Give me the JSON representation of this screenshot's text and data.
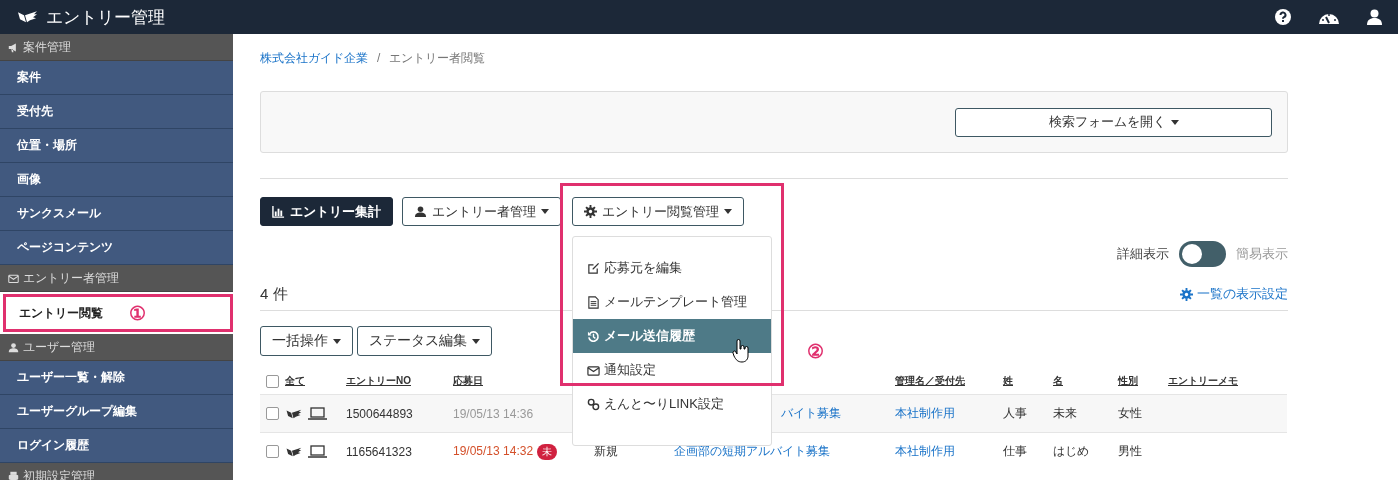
{
  "header": {
    "title": "エントリー管理"
  },
  "sidebar": {
    "sections": [
      {
        "title": "案件管理",
        "items": [
          {
            "label": "案件",
            "selected": false
          },
          {
            "label": "受付先",
            "selected": false
          },
          {
            "label": "位置・場所",
            "selected": false
          },
          {
            "label": "画像",
            "selected": false
          },
          {
            "label": "サンクスメール",
            "selected": false
          },
          {
            "label": "ページコンテンツ",
            "selected": false
          }
        ]
      },
      {
        "title": "エントリー者管理",
        "items": [
          {
            "label": "エントリー閲覧",
            "selected": true,
            "annotation": "①"
          }
        ]
      },
      {
        "title": "ユーザー管理",
        "items": [
          {
            "label": "ユーザー一覧・解除",
            "selected": false
          },
          {
            "label": "ユーザーグループ編集",
            "selected": false
          },
          {
            "label": "ログイン履歴",
            "selected": false
          }
        ]
      },
      {
        "title": "初期設定管理"
      }
    ]
  },
  "breadcrumb": {
    "separator": "/",
    "items": [
      {
        "label": "株式会社ガイド企業",
        "kind": "link"
      },
      {
        "label": "エントリー者閲覧",
        "kind": "current"
      }
    ]
  },
  "search_panel": {
    "button": "検索フォームを開く"
  },
  "toolbar": [
    {
      "label": "エントリー集計",
      "kind": "primary",
      "open": false
    },
    {
      "label": "エントリー者管理",
      "kind": "dropdown",
      "open": false
    },
    {
      "label": "エントリー閲覧管理",
      "kind": "dropdown",
      "open": true,
      "annotation": "②",
      "menu": [
        {
          "label": "応募元を編集",
          "selected": false
        },
        {
          "label": "メールテンプレート管理",
          "selected": false
        },
        {
          "label": "メール送信履歴",
          "selected": true
        },
        {
          "label": "通知設定",
          "selected": false
        },
        {
          "label": "えんと〜りLINK設定",
          "selected": false
        }
      ]
    }
  ],
  "view_toggle": {
    "left_label": "詳細表示",
    "right_label": "簡易表示",
    "on": false
  },
  "count": "4 件",
  "display_settings_link": "一覧の表示設定",
  "bulk_buttons": [
    "一括操作",
    "ステータス編集"
  ],
  "table": {
    "select_all_checked": false,
    "columns": [
      "全て",
      "エントリーNO",
      "応募日",
      "管理名／受付先",
      "姓",
      "名",
      "性別",
      "エントリーメモ"
    ],
    "rows": [
      {
        "checked": false,
        "entry_no": "1500644893",
        "date": "19/05/13 14:36",
        "unread": false,
        "column_5": "バイト募集",
        "manager": "本社制作用",
        "last_name": "人事",
        "first_name": "未来",
        "gender": "女性"
      },
      {
        "checked": false,
        "entry_no": "1165641323",
        "date": "19/05/13 14:32",
        "unread": true,
        "badge": "未",
        "column_4": "新規",
        "column_5": "企画部の短期アルバイト募集",
        "manager": "本社制作用",
        "last_name": "仕事",
        "first_name": "はじめ",
        "gender": "男性"
      }
    ]
  }
}
